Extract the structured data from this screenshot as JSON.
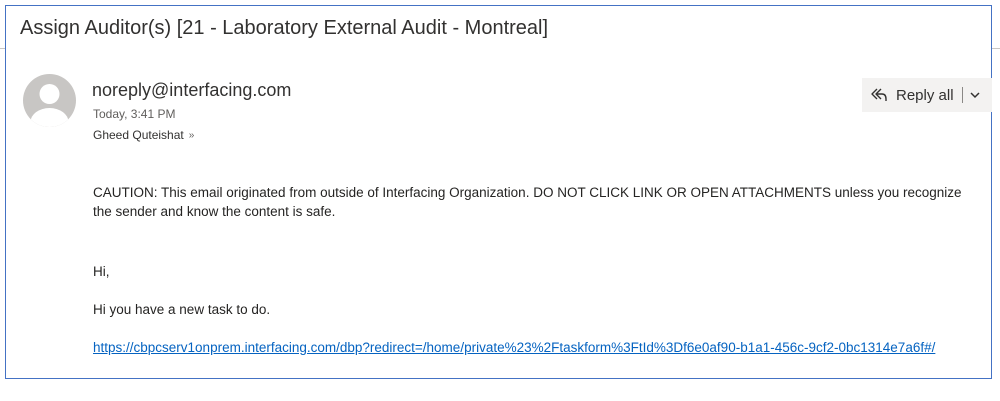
{
  "email": {
    "subject": "Assign Auditor(s) [21 - Laboratory External Audit - Montreal]",
    "sender": "noreply@interfacing.com",
    "time": "Today, 3:41 PM",
    "recipient": "Gheed Quteishat",
    "actions": {
      "reply_all_label": "Reply all",
      "reply_icon": "reply-all-icon",
      "more_icon": "chevron-down-icon"
    },
    "body": {
      "caution": "CAUTION: This email originated from outside of Interfacing Organization. DO NOT CLICK LINK OR OPEN ATTACHMENTS unless you recognize the sender and know the content is safe.",
      "greeting": "Hi,",
      "message": "Hi you have a new task to do.",
      "link_text": "https://cbpcserv1onprem.interfacing.com/dbp?redirect=/home/private%23%2Ftaskform%3FtId%3Df6e0af90-b1a1-456c-9cf2-0bc1314e7a6f#/"
    }
  },
  "colors": {
    "frame_border": "#4472c4",
    "link": "#0563c1",
    "avatar_bg": "#c8c6c4",
    "button_bg": "#f3f2f1"
  }
}
